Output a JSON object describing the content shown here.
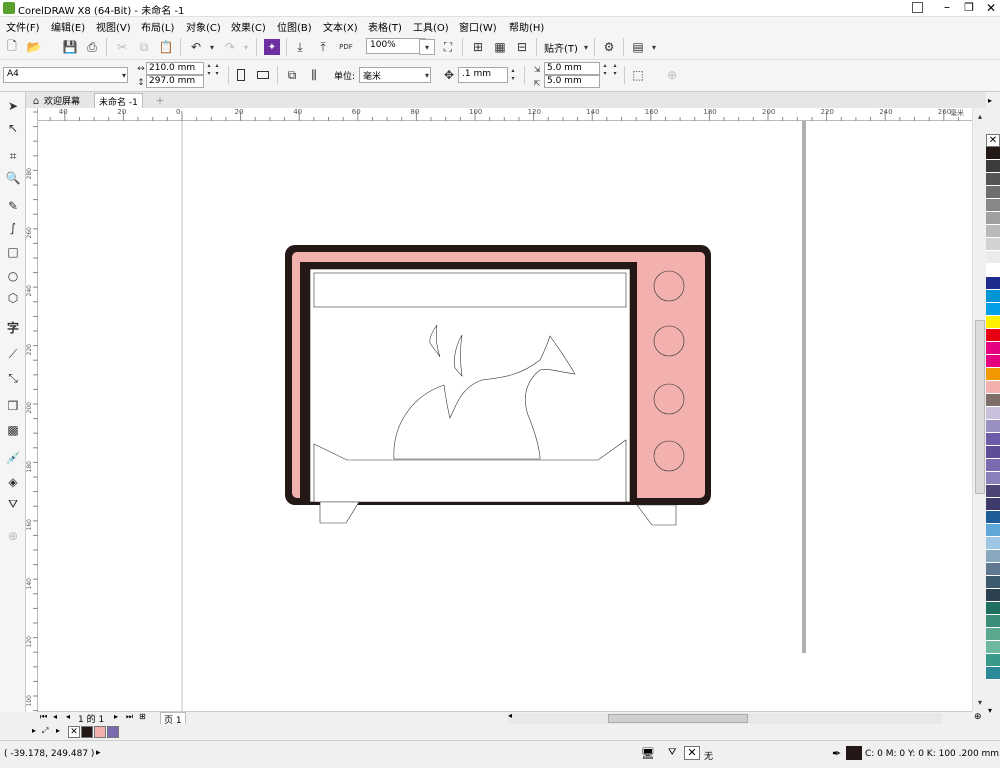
{
  "window": {
    "title": "CorelDRAW X8 (64-Bit) - 未命名 -1"
  },
  "menu": [
    "文件(F)",
    "编辑(E)",
    "视图(V)",
    "布局(L)",
    "对象(C)",
    "效果(C)",
    "位图(B)",
    "文本(X)",
    "表格(T)",
    "工具(O)",
    "窗口(W)",
    "帮助(H)"
  ],
  "toolbar": {
    "zoom": "100%",
    "snap_label": "贴齐(T)",
    "pdf_label": "PDF"
  },
  "property_bar": {
    "paper_size": "A4",
    "width": "210.0 mm",
    "height": "297.0 mm",
    "units_label": "单位:",
    "units_value": "毫米",
    "nudge": ".1 mm",
    "dup_x": "5.0 mm",
    "dup_y": "5.0 mm"
  },
  "tabs": [
    {
      "label": "欢迎屏幕"
    },
    {
      "label": "未命名 -1"
    }
  ],
  "ruler_h": [
    "40",
    "20",
    "0",
    "20",
    "40",
    "60",
    "80",
    "100",
    "120",
    "140",
    "160",
    "180",
    "200",
    "220",
    "240",
    "260",
    "毫米"
  ],
  "ruler_v": [
    "280",
    "260",
    "240",
    "220",
    "200",
    "180",
    "160",
    "140",
    "120",
    "100"
  ],
  "page_nav": {
    "counter": "1 的 1",
    "page_tab": "页 1"
  },
  "status": {
    "coords": "( -39.178, 249.487 )",
    "fill": "无",
    "outline": "C: 0 M: 0 Y: 0 K: 100  .200 mm"
  },
  "colors": {
    "oven_body": "#f2b0ae",
    "oven_frame": "#231815",
    "accent": "#6b2fa0"
  },
  "palette_colors": [
    "#231815",
    "#3c3c3c",
    "#555555",
    "#6e6e6e",
    "#878787",
    "#a0a0a0",
    "#b9b9b9",
    "#d2d2d2",
    "#ebebeb",
    "#ffffff",
    "#1e2a8c",
    "#0096d6",
    "#00a0e9",
    "#fff100",
    "#e60012",
    "#e5007f",
    "#e4007f",
    "#f39800",
    "#f2b0ae",
    "#7d6e68",
    "#c9c0db",
    "#9a8fc1",
    "#6b5ba8",
    "#5e4e99",
    "#7a6ab0",
    "#8a7fb8",
    "#4d4477",
    "#3e3a6b",
    "#1d5b99",
    "#5ea8d8",
    "#9ec7e6",
    "#88a8c0",
    "#607890",
    "#3e5a6e",
    "#2c4050",
    "#1e6f60",
    "#3a8f7a",
    "#5aa890",
    "#6fb8a0",
    "#3a9a8a",
    "#2a8a9a"
  ],
  "doc_palette": [
    "#ffffff",
    "#231815",
    "#f2b0ae",
    "#7a6ab0"
  ]
}
